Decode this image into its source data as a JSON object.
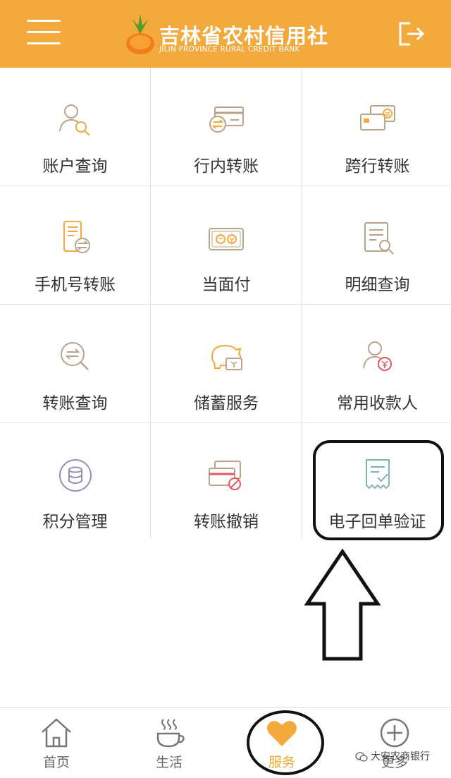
{
  "header": {
    "brand_cn": "吉林省农村信用社",
    "brand_en": "JILIN PROVINCE RURAL CREDIT BANK"
  },
  "colors": {
    "accent": "#f4a93c",
    "icon_line": "#b9a48a",
    "icon_accent": "#f4a93c"
  },
  "grid": {
    "items": [
      {
        "label": "账户查询",
        "icon": "user-search-icon"
      },
      {
        "label": "行内转账",
        "icon": "card-transfer-icon"
      },
      {
        "label": "跨行转账",
        "icon": "cards-exchange-icon"
      },
      {
        "label": "手机号转账",
        "icon": "phone-transfer-icon"
      },
      {
        "label": "当面付",
        "icon": "face-pay-icon"
      },
      {
        "label": "明细查询",
        "icon": "detail-search-icon"
      },
      {
        "label": "转账查询",
        "icon": "transfer-search-icon"
      },
      {
        "label": "储蓄服务",
        "icon": "piggy-bank-icon"
      },
      {
        "label": "常用收款人",
        "icon": "payee-icon"
      },
      {
        "label": "积分管理",
        "icon": "points-coin-icon"
      },
      {
        "label": "转账撤销",
        "icon": "transfer-cancel-icon"
      },
      {
        "label": "电子回单验证",
        "icon": "receipt-verify-icon"
      }
    ]
  },
  "tabbar": {
    "tabs": [
      {
        "label": "首页",
        "icon": "home-icon"
      },
      {
        "label": "生活",
        "icon": "coffee-cup-icon"
      },
      {
        "label": "服务",
        "icon": "heart-icon",
        "active": true
      },
      {
        "label": "更多",
        "icon": "plus-circle-icon"
      }
    ]
  },
  "watermark": {
    "text": "大安农商银行"
  }
}
